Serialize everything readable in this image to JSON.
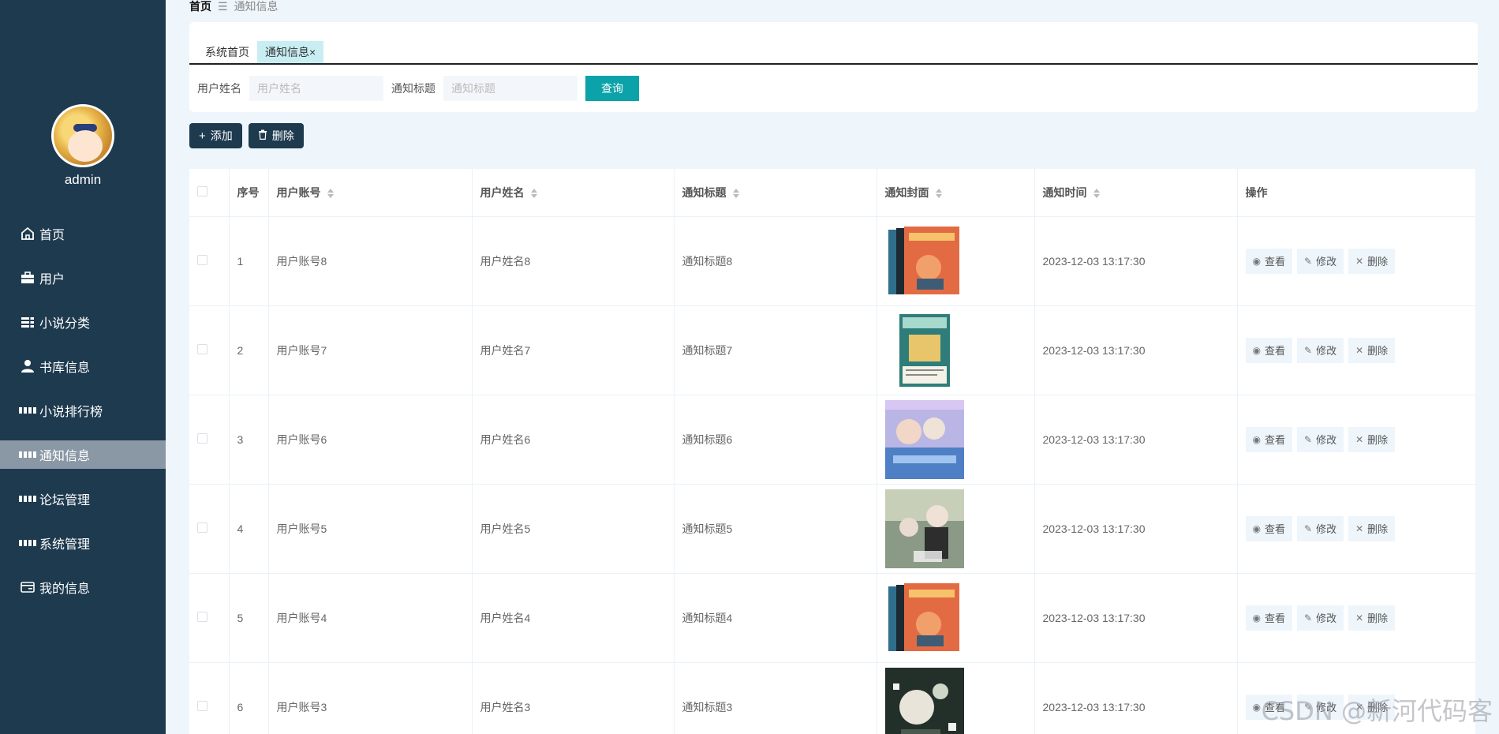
{
  "sidebar": {
    "username": "admin",
    "items": [
      {
        "label": "首页",
        "icon": "home-icon"
      },
      {
        "label": "用户",
        "icon": "briefcase-icon"
      },
      {
        "label": "小说分类",
        "icon": "list-icon"
      },
      {
        "label": "书库信息",
        "icon": "person-icon"
      },
      {
        "label": "小说排行榜",
        "icon": "grid-icon"
      },
      {
        "label": "通知信息",
        "icon": "grid-icon",
        "active": true
      },
      {
        "label": "论坛管理",
        "icon": "grid-icon"
      },
      {
        "label": "系统管理",
        "icon": "grid-icon"
      },
      {
        "label": "我的信息",
        "icon": "card-icon"
      }
    ]
  },
  "breadcrumb": {
    "home": "首页",
    "separator": "☰",
    "current": "通知信息"
  },
  "tabs": [
    {
      "label": "系统首页"
    },
    {
      "label": "通知信息",
      "close": "×"
    }
  ],
  "search": {
    "name_label": "用户姓名",
    "name_placeholder": "用户姓名",
    "title_label": "通知标题",
    "title_placeholder": "通知标题",
    "query_label": "查询"
  },
  "toolbar": {
    "add_label": "添加",
    "delete_label": "删除"
  },
  "table": {
    "columns": [
      "序号",
      "用户账号",
      "用户姓名",
      "通知标题",
      "通知封面",
      "通知时间",
      "操作"
    ],
    "rows": [
      {
        "index": "1",
        "account": "用户账号8",
        "name": "用户姓名8",
        "title": "通知标题8",
        "time": "2023-12-03 13:17:30"
      },
      {
        "index": "2",
        "account": "用户账号7",
        "name": "用户姓名7",
        "title": "通知标题7",
        "time": "2023-12-03 13:17:30"
      },
      {
        "index": "3",
        "account": "用户账号6",
        "name": "用户姓名6",
        "title": "通知标题6",
        "time": "2023-12-03 13:17:30"
      },
      {
        "index": "4",
        "account": "用户账号5",
        "name": "用户姓名5",
        "title": "通知标题5",
        "time": "2023-12-03 13:17:30"
      },
      {
        "index": "5",
        "account": "用户账号4",
        "name": "用户姓名4",
        "title": "通知标题4",
        "time": "2023-12-03 13:17:30"
      },
      {
        "index": "6",
        "account": "用户账号3",
        "name": "用户姓名3",
        "title": "通知标题3",
        "time": "2023-12-03 13:17:30"
      }
    ],
    "ops": {
      "view": "查看",
      "edit": "修改",
      "delete": "删除"
    }
  },
  "watermark": "CSDN @新河代码客"
}
